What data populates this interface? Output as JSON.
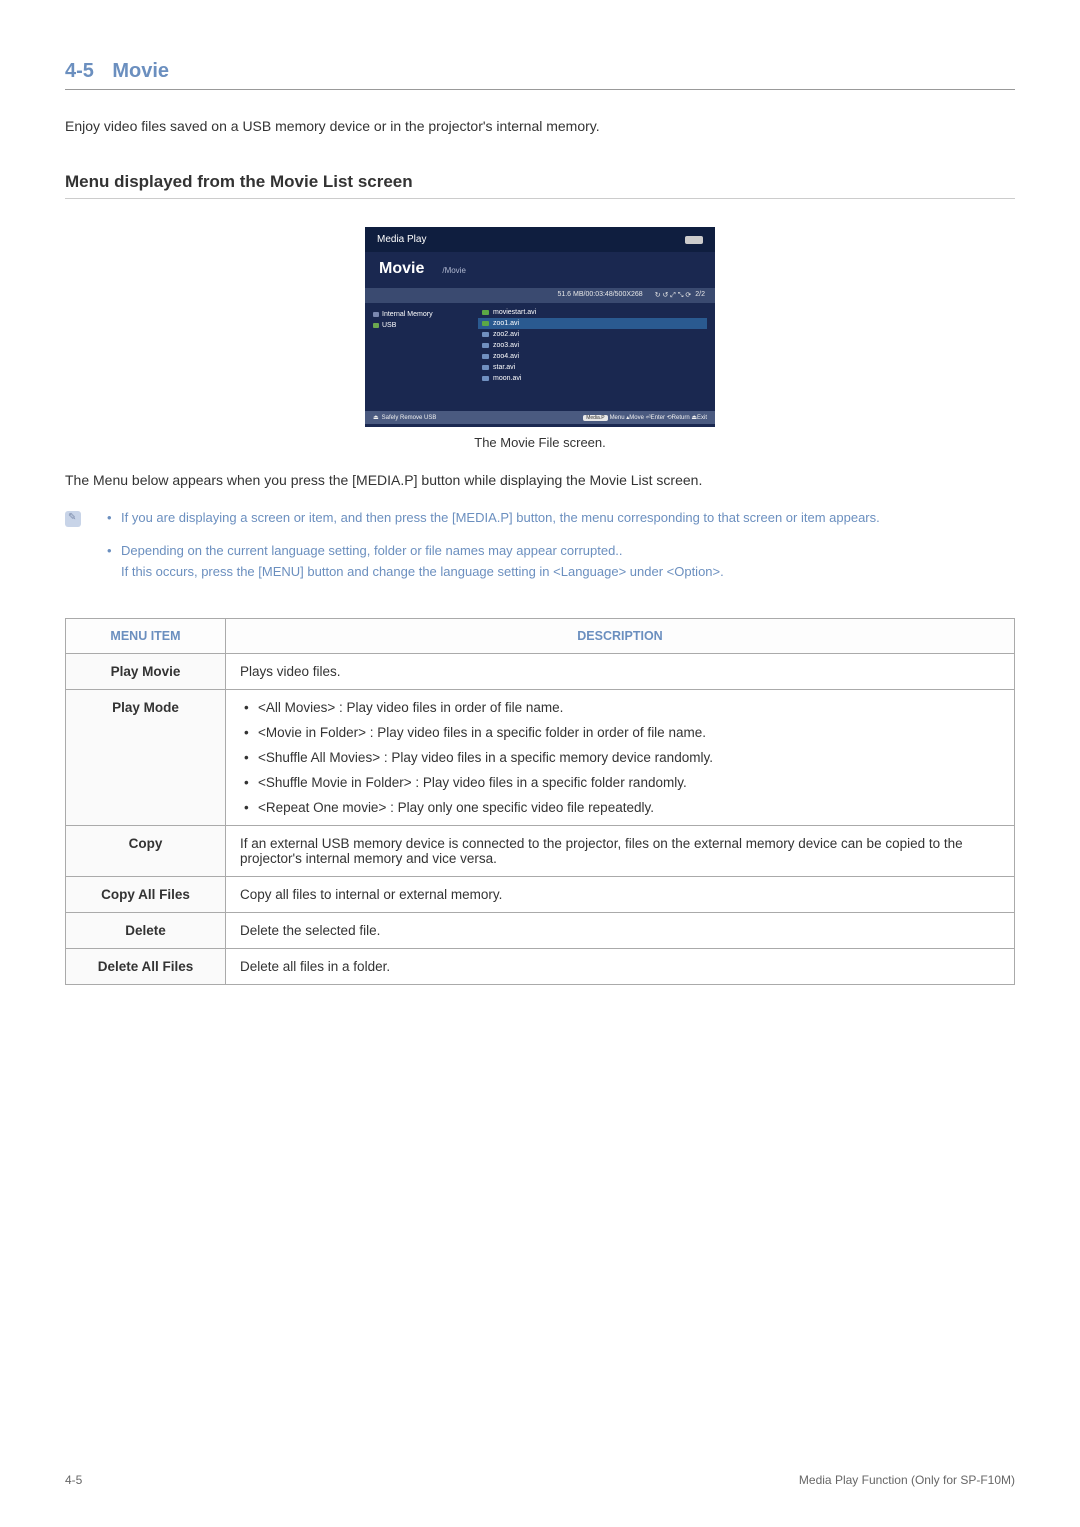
{
  "section": {
    "number": "4-5",
    "title": "Movie"
  },
  "intro": "Enjoy video files saved on a USB memory device or in the projector's internal memory.",
  "subsection": "Menu displayed from the Movie List screen",
  "screenshot": {
    "header": "Media Play",
    "movie_title": "Movie",
    "movie_path": "/Movie",
    "info_bar": "51.6 MB/00:03:48/500X268",
    "page_count": "2/2",
    "sidebar": {
      "internal": "Internal Memory",
      "usb": "USB"
    },
    "files": [
      "moviestart.avi",
      "zoo1.avi",
      "zoo2.avi",
      "zoo3.avi",
      "zoo4.avi",
      "star.avi",
      "moon.avi"
    ],
    "footer_left": "Safely Remove USB",
    "footer_badge": "Media.P",
    "footer_hints": "Menu  ▴Move  ⏎Enter  ⟲Return  ⏏Exit"
  },
  "caption": "The Movie File screen.",
  "body_text": "The Menu below appears when you press the [MEDIA.P] button while displaying the Movie List screen.",
  "notes": {
    "n1": "If you are displaying a screen or item, and then press the [MEDIA.P] button, the menu corresponding to that screen or item appears.",
    "n2": "Depending on the current language setting, folder or file names may appear corrupted..",
    "n2_indent": "If this occurs, press the [MENU] button and change the language setting in <Language> under <Option>."
  },
  "table": {
    "headers": {
      "col1": "MENU ITEM",
      "col2": "DESCRIPTION"
    },
    "rows": {
      "play_movie": {
        "label": "Play Movie",
        "desc": "Plays video files."
      },
      "play_mode": {
        "label": "Play Mode",
        "items": {
          "i1": "<All Movies> : Play video files in order of file name.",
          "i2": "<Movie in Folder> : Play video files in a specific folder in order of file name.",
          "i3": "<Shuffle All Movies> : Play video files in a specific memory device randomly.",
          "i4": "<Shuffle Movie in Folder> : Play video files in a specific folder randomly.",
          "i5": "<Repeat One movie> : Play only one specific video file repeatedly."
        }
      },
      "copy": {
        "label": "Copy",
        "desc": "If an external USB memory device is connected to the projector, files on the external memory device can be copied to the projector's internal memory and vice versa."
      },
      "copy_all": {
        "label": "Copy All Files",
        "desc": "Copy all files to internal or external memory."
      },
      "delete": {
        "label": "Delete",
        "desc": "Delete the selected file."
      },
      "delete_all": {
        "label": "Delete All Files",
        "desc": "Delete all files in a folder."
      }
    }
  },
  "footer": {
    "left": "4-5",
    "right": "Media Play Function (Only for SP-F10M)"
  }
}
